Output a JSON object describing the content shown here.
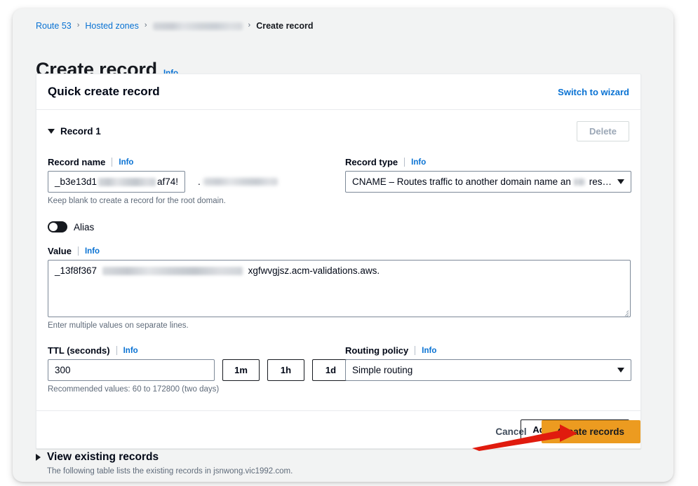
{
  "breadcrumb": {
    "items": [
      {
        "label": "Route 53",
        "type": "link"
      },
      {
        "label": "Hosted zones",
        "type": "link"
      },
      {
        "label": "",
        "type": "redacted"
      },
      {
        "label": "Create record",
        "type": "current"
      }
    ],
    "separator": "›"
  },
  "page": {
    "title": "Create record",
    "info_label": "Info"
  },
  "container": {
    "title": "Quick create record",
    "switch_link": "Switch to wizard"
  },
  "record": {
    "label": "Record 1",
    "collapse_icon": "triangle-down",
    "delete_label": "Delete",
    "name": {
      "label": "Record name",
      "info": "Info",
      "value_prefix": "_b3e13d1",
      "value_suffix": "af74!",
      "domain_dot": ".",
      "hint": "Keep blank to create a record for the root domain."
    },
    "type": {
      "label": "Record type",
      "info": "Info",
      "value": "CNAME – Routes traffic to another domain name and to some",
      "value_tail": "res…"
    },
    "alias": {
      "label": "Alias",
      "enabled": false
    },
    "value": {
      "label": "Value",
      "info": "Info",
      "text_prefix": "_13f8f367",
      "text_suffix": "xgfwvgjsz.acm-validations.aws.",
      "hint": "Enter multiple values on separate lines."
    },
    "ttl": {
      "label": "TTL (seconds)",
      "info": "Info",
      "value": "300",
      "quick_buttons": [
        "1m",
        "1h",
        "1d"
      ],
      "hint": "Recommended values: 60 to 172800 (two days)"
    },
    "routing": {
      "label": "Routing policy",
      "info": "Info",
      "value": "Simple routing"
    }
  },
  "footer": {
    "add_record_label": "Add another record"
  },
  "actions": {
    "cancel_label": "Cancel",
    "create_label": "Create records"
  },
  "view_existing": {
    "title": "View existing records",
    "description": "The following table lists the existing records in jsnwong.vic1992.com.",
    "expand_icon": "triangle-right"
  },
  "colors": {
    "link_blue": "#0972d3",
    "primary_orange": "#ec9b20",
    "page_bg": "#f2f3f3",
    "annotation_red": "#e01b0e"
  }
}
